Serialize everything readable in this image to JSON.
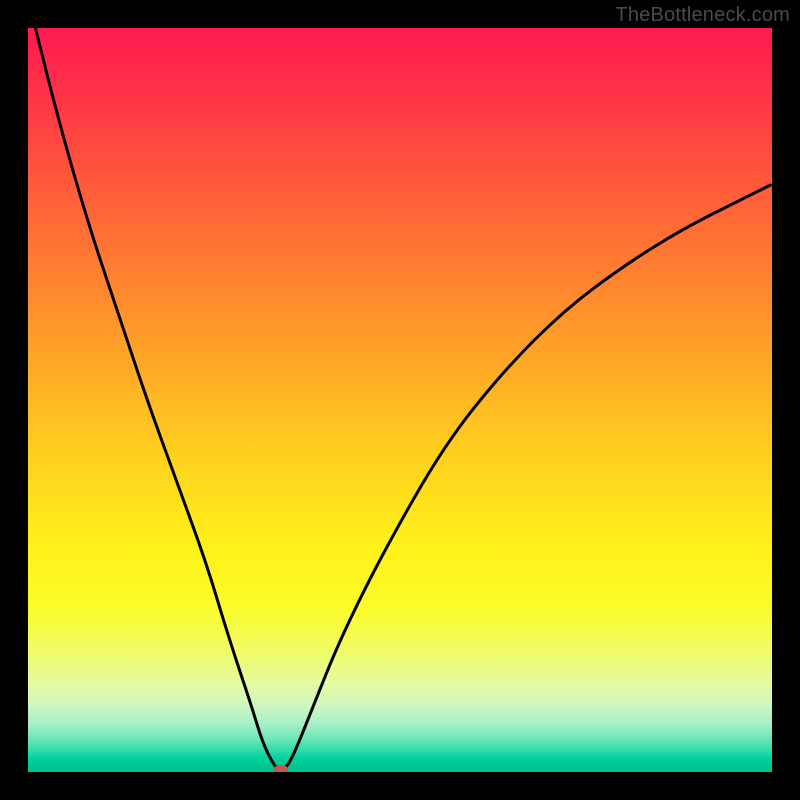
{
  "watermark": "TheBottleneck.com",
  "plot": {
    "width_pct": 100,
    "height_pct": 100,
    "curve_stroke": "#000000",
    "curve_stroke_width": 3,
    "dot_color": "#c4584b"
  },
  "chart_data": {
    "type": "line",
    "title": "",
    "xlabel": "",
    "ylabel": "",
    "xlim": [
      0,
      100
    ],
    "ylim": [
      0,
      100
    ],
    "annotations": [
      "TheBottleneck.com"
    ],
    "notes": "Background vertical gradient from red (top, high bottleneck) through orange/yellow to green (bottom, low bottleneck). Single black V-shaped curve with minimum marked by small red dot near x≈34.",
    "series": [
      {
        "name": "bottleneck-curve",
        "x": [
          1,
          4,
          8,
          12,
          16,
          20,
          24,
          27,
          30,
          31.5,
          33,
          34,
          35,
          36,
          38,
          42,
          48,
          56,
          64,
          72,
          80,
          88,
          96,
          100
        ],
        "y": [
          100,
          88,
          74,
          62,
          50,
          39,
          28,
          18,
          9,
          4,
          1,
          0,
          1,
          3,
          8,
          18,
          30,
          44,
          54,
          62,
          68,
          73,
          77,
          79
        ]
      }
    ],
    "marker": {
      "x": 34,
      "y": 0
    },
    "gradient_stops": [
      {
        "pos": 0,
        "color": "#ff1a4f"
      },
      {
        "pos": 15,
        "color": "#ff4740"
      },
      {
        "pos": 36,
        "color": "#ff8a2e"
      },
      {
        "pos": 58,
        "color": "#ffd21e"
      },
      {
        "pos": 78,
        "color": "#fafc2a"
      },
      {
        "pos": 91,
        "color": "#d0f7c0"
      },
      {
        "pos": 97,
        "color": "#33dcab"
      },
      {
        "pos": 100,
        "color": "#00c090"
      }
    ]
  }
}
